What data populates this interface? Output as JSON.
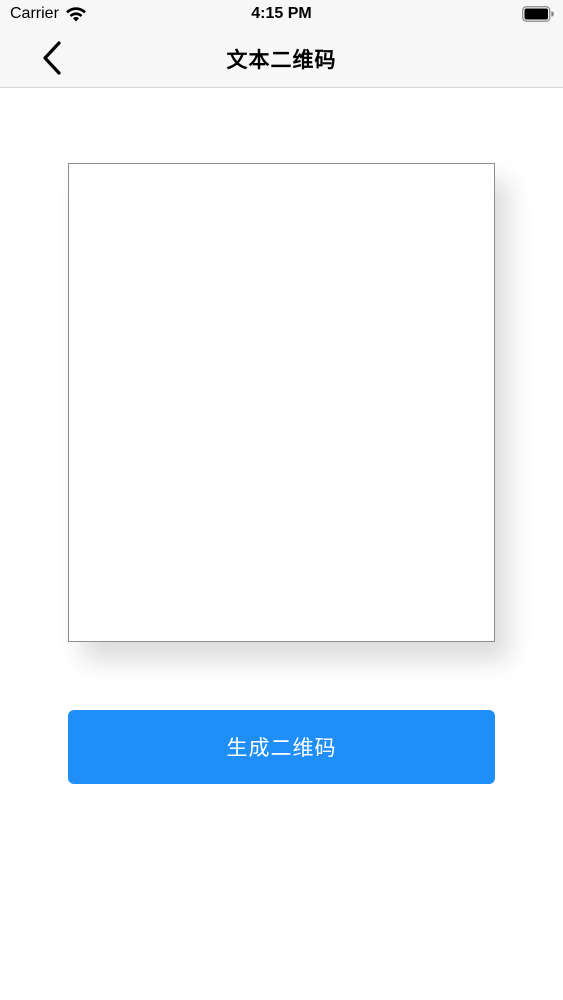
{
  "status_bar": {
    "carrier": "Carrier",
    "time": "4:15 PM",
    "wifi_icon": "wifi-icon",
    "battery_icon": "battery-icon"
  },
  "nav_bar": {
    "back_icon": "chevron-left-icon",
    "title": "文本二维码"
  },
  "qr_preview": {
    "content": ""
  },
  "generate_button": {
    "label": "生成二维码",
    "color": "#1f8ff7"
  }
}
